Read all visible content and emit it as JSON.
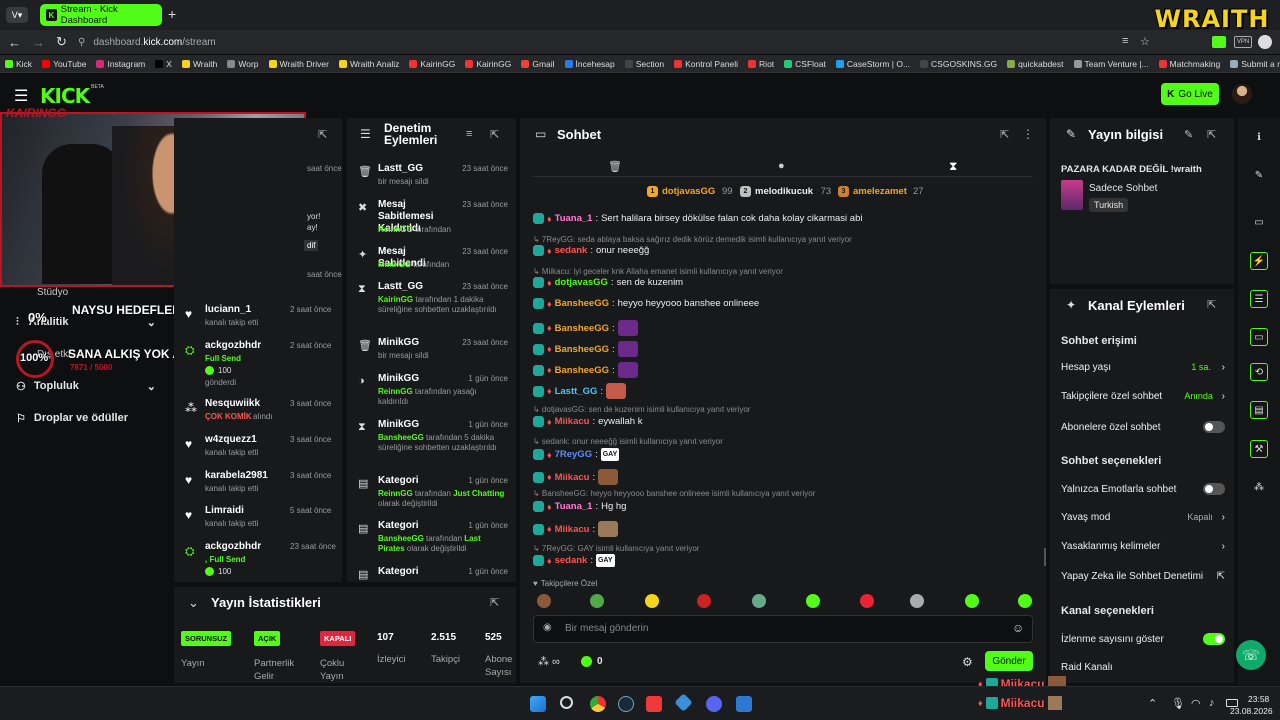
{
  "browser": {
    "tab_title": "Stream - Kick Dashboard",
    "url_prefix": "dashboard.",
    "url_domain": "kick.com",
    "url_path": "/stream",
    "bookmarks": [
      "Kick",
      "YouTube",
      "Instagram",
      "X",
      "Wraith",
      "Worp",
      "Wraith Driver",
      "Wraith Analiz",
      "KairinGG",
      "KairinGG",
      "Gmail",
      "İncehesap",
      "Section",
      "Kontrol Paneli",
      "Riot",
      "CSFloat",
      "CaseStorm | O...",
      "CSGOSKINS.GG",
      "quickabdest",
      "Team Venture |...",
      "Matchmaking",
      "Submit a reque..."
    ]
  },
  "overlay": {
    "brand": "WRAITH",
    "channel": "KAIRINGG",
    "goal1_pct": "0%",
    "goal1_label": "NAYSU HEDEFLER",
    "goal2_pct": "100%",
    "goal2_label": "SANA ALKIŞ YOK ANCA KICK",
    "goal2_progress": "7871 / 5000"
  },
  "header": {
    "logo": "KICK",
    "logo_sup": "BETA",
    "go_live": "Go Live"
  },
  "sidebar": {
    "items": [
      "Stüdyo",
      "Analitik",
      "Dış etki...",
      "Topluluk",
      "Droplar ve ödüller"
    ]
  },
  "activity": {
    "partial": [
      "a",
      "saat önce",
      "yor!",
      "ay!",
      "dif",
      "saat önce"
    ],
    "items": [
      {
        "user": "luciann_1",
        "desc": "kanalı takip etti",
        "time": "2 saat önce"
      },
      {
        "user": "ackgozbhdr",
        "desc": "Full Send",
        "extra": "100",
        "extra2": "gönderdi",
        "time": "2 saat önce"
      },
      {
        "user": "Nesquwiikk",
        "desc": "ÇOK KOMİK",
        "desc2": "alındı",
        "time": "3 saat önce"
      },
      {
        "user": "w4zquezz1",
        "desc": "kanalı takip etti",
        "time": "3 saat önce"
      },
      {
        "user": "karabela2981",
        "desc": "kanalı takip etti",
        "time": "3 saat önce"
      },
      {
        "user": "Limraidi",
        "desc": "kanalı takip etti",
        "time": "5 saat önce"
      },
      {
        "user": "ackgozbhdr",
        "desc": ", Full Send",
        "extra": "100",
        "time": "23 saat önce"
      }
    ]
  },
  "moderation": {
    "title_line1": "Denetim",
    "title_line2": "Eylemleri",
    "items": [
      {
        "title": "Lastt_GG",
        "by": "",
        "desc": "bir mesajı sildi",
        "time": "23 saat önce"
      },
      {
        "title": "Mesaj Sabitlemesi Kaldırıldı",
        "by": "ReinnGG",
        "desc": "tarafından",
        "time": "23 saat önce"
      },
      {
        "title": "Mesaj Sabitlendi",
        "by": "MinikGG",
        "desc": "tarafından",
        "time": "23 saat önce"
      },
      {
        "title": "Lastt_GG",
        "by": "KairinGG",
        "desc": "tarafından 1 dakika süreliğine sohbetten uzaklaştırıldı",
        "time": "23 saat önce"
      },
      {
        "title": "MinikGG",
        "by": "",
        "desc": "bir mesajı sildi",
        "time": "23 saat önce"
      },
      {
        "title": "MinikGG",
        "by": "ReinnGG",
        "desc": "tarafından yasağı kaldırıldı",
        "time": "1 gün önce"
      },
      {
        "title": "MinikGG",
        "by": "BansheeGG",
        "desc": "tarafından 5 dakika süreliğine sohbetten uzaklaştırıldı",
        "time": "1 gün önce"
      },
      {
        "title": "Kategori",
        "by": "ReinnGG",
        "desc": "tarafından",
        "hl": "Just Chatting",
        "desc2": "olarak değiştirildi",
        "time": "1 gün önce"
      },
      {
        "title": "Kategori",
        "by": "BansheeGG",
        "desc": "tarafından",
        "hl": "Last Pirates",
        "desc2": "olarak değiştirildi",
        "time": "1 gün önce"
      },
      {
        "title": "Kategori",
        "by": "",
        "desc": "",
        "time": "1 gün önce"
      }
    ]
  },
  "chat": {
    "title": "Sohbet",
    "leaders": [
      {
        "rank": "1",
        "name": "dotjavasGG",
        "count": "99",
        "color": "#f5a623"
      },
      {
        "rank": "2",
        "name": "melodikucuk",
        "count": "73",
        "color": "#c0c0c0"
      },
      {
        "rank": "3",
        "name": "amelezamet",
        "count": "27",
        "color": "#cd7f32"
      }
    ],
    "messages": [
      {
        "type": "msg",
        "user": "Tuana_1",
        "color": "#ff7ad9",
        "text": "Sert halilara birsey dökülse falan cok daha kolay cikarmasi abi"
      },
      {
        "type": "reply",
        "text": "7ReyGG: seda ablaya baksa sağırız dedik körüz demedik isimli kullanıcıya yanıt veriyor"
      },
      {
        "type": "msg",
        "user": "sedank",
        "color": "#ff5252",
        "text": "onur neeeğğ"
      },
      {
        "type": "reply",
        "text": "Miikacu: iyi geceler knk Allaha emanet isimli kullanıcıya yanıt veriyor"
      },
      {
        "type": "msg",
        "user": "dotjavasGG",
        "color": "#53fc18",
        "text": "sen de kuzenim"
      },
      {
        "type": "msg",
        "user": "BansheeGG",
        "color": "#f5a623",
        "text": "heyyo heyyooo banshee onlineee"
      },
      {
        "type": "msg",
        "user": "BansheeGG",
        "color": "#f5a623",
        "text": ""
      },
      {
        "type": "msg",
        "user": "BansheeGG",
        "color": "#f5a623",
        "text": ""
      },
      {
        "type": "msg",
        "user": "BansheeGG",
        "color": "#f5a623",
        "text": ""
      },
      {
        "type": "msg",
        "user": "Lastt_GG",
        "color": "#4fc3f7",
        "text": ""
      },
      {
        "type": "reply",
        "text": "dotjavasGG: sen de kuzenim isimli kullanıcıya yanıt veriyor"
      },
      {
        "type": "msg",
        "user": "Miikacu",
        "color": "#ff5252",
        "text": "eywallah k"
      },
      {
        "type": "reply",
        "text": "sedank: onur neeeğğ isimli kullanıcıya yanıt veriyor"
      },
      {
        "type": "msg",
        "user": "7ReyGG",
        "color": "#5b8cff",
        "text": "GAY"
      },
      {
        "type": "msg",
        "user": "Miikacu",
        "color": "#ff5252",
        "text": ""
      },
      {
        "type": "reply",
        "text": "BansheeGG: heyyo heyyooo banshee onlineee isimli kullanıcıya yanıt veriyor"
      },
      {
        "type": "msg",
        "user": "Tuana_1",
        "color": "#ff7ad9",
        "text": "Hg hg"
      },
      {
        "type": "msg",
        "user": "Miikacu",
        "color": "#ff5252",
        "text": ""
      },
      {
        "type": "reply",
        "text": "7ReyGG: GAY isimli kullanıcıya yanıt veriyor"
      },
      {
        "type": "msg",
        "user": "sedank",
        "color": "#ff5252",
        "text": "GAY"
      }
    ],
    "followers_only": "Takipçilere Özel",
    "placeholder": "Bir mesaj gönderin",
    "points": "0",
    "send": "Gönder"
  },
  "stats": {
    "title": "Yayın İstatistikleri",
    "items": [
      {
        "tag": "SORUNSUZ",
        "label": "Yayın",
        "tagcolor": "#53fc18"
      },
      {
        "tag": "AÇIK",
        "label": "Partnerlik Gelir",
        "tagcolor": "#53fc18"
      },
      {
        "tag": "KAPALI",
        "label": "Çoklu Yayın",
        "tagcolor": "#e0263c"
      },
      {
        "value": "107",
        "label": "İzleyici"
      },
      {
        "value": "2.515",
        "label": "Takipçi"
      },
      {
        "value": "525",
        "label": "Abone Sayısı"
      }
    ]
  },
  "stream_info": {
    "title": "Yayın bilgisi",
    "stream_title": "PAZARA KADAR DEĞİL !wraith",
    "category": "Sadece Sohbet",
    "language": "Turkish"
  },
  "channel_actions": {
    "title": "Kanal Eylemleri",
    "section1": "Sohbet erişimi",
    "account_age": "Hesap yaşı",
    "account_age_val": "1 sa.",
    "followers_chat": "Takipçilere özel sohbet",
    "followers_chat_val": "Anında",
    "subs_chat": "Abonelere özel sohbet",
    "section2": "Sohbet seçenekleri",
    "emote_only": "Yalnızca Emotlarla sohbet",
    "slow_mode": "Yavaş mod",
    "slow_mode_val": "Kapalı",
    "banned_words": "Yasaklanmış kelimeler",
    "ai_mod": "Yapay Zeka ile Sohbet Denetimi",
    "section3": "Kanal seçenekleri",
    "show_viewers": "İzlenme sayısını göster",
    "raid": "Raid Kanalı"
  },
  "taskbar": {
    "time": "23:58",
    "date": "23.08.2026",
    "overlay_user": "Miikacu"
  }
}
